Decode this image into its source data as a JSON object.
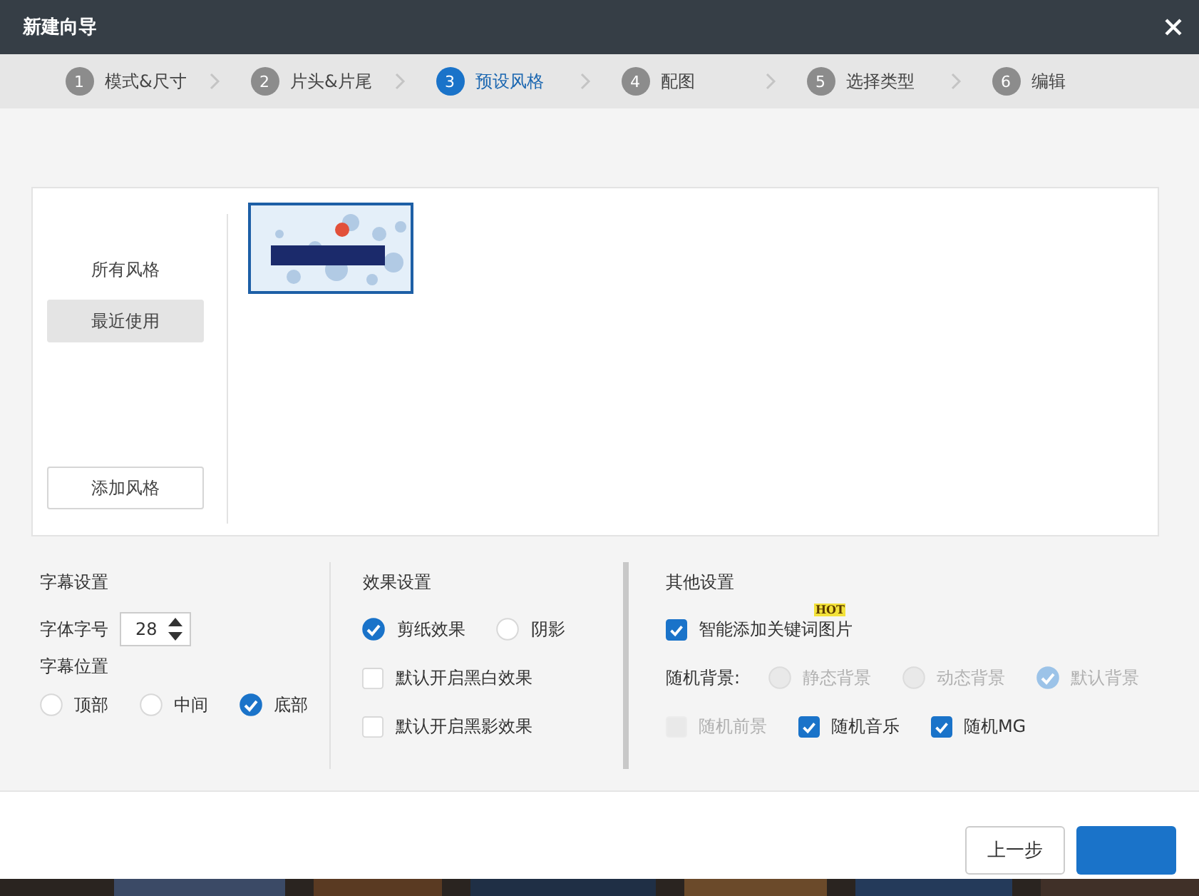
{
  "window": {
    "title": "新建向导"
  },
  "steps": [
    {
      "number": "1",
      "label": "模式&尺寸",
      "selected": false
    },
    {
      "number": "2",
      "label": "片头&片尾",
      "selected": false
    },
    {
      "number": "3",
      "label": "预设风格",
      "selected": true
    },
    {
      "number": "4",
      "label": "配图",
      "selected": false
    },
    {
      "number": "5",
      "label": "选择类型",
      "selected": false
    },
    {
      "number": "6",
      "label": "编辑",
      "selected": false
    }
  ],
  "style_panel": {
    "categories": [
      {
        "label": "所有风格",
        "selected": false
      },
      {
        "label": "最近使用",
        "selected": true
      }
    ],
    "add_button": "添加风格",
    "thumbnails": [
      {
        "kind": "picture",
        "selected": true
      }
    ]
  },
  "subtitle_settings": {
    "title": "字幕设置",
    "font_size": {
      "label": "字体字号",
      "value": "28"
    },
    "position": {
      "label": "字幕位置",
      "options": [
        {
          "label": "顶部",
          "selected": false
        },
        {
          "label": "中间",
          "selected": false
        },
        {
          "label": "底部",
          "selected": true
        }
      ]
    }
  },
  "effect_settings": {
    "title": "效果设置",
    "styles": [
      {
        "label": "剪纸效果",
        "selected": true
      },
      {
        "label": "阴影",
        "selected": false
      }
    ],
    "checkboxes": [
      {
        "label": "默认开启黑白效果",
        "checked": false
      },
      {
        "label": "默认开启黑影效果",
        "checked": false
      }
    ]
  },
  "other_settings": {
    "title": "其他设置",
    "smart_images": {
      "label": "智能添加关键词图片",
      "checked": true,
      "badge": "HOT"
    },
    "random_background": {
      "label": "随机背景:",
      "options": [
        {
          "label": "静态背景",
          "selected": false,
          "disabled": true
        },
        {
          "label": "动态背景",
          "selected": false,
          "disabled": true
        },
        {
          "label": "默认背景",
          "selected": true,
          "disabled": true
        }
      ]
    },
    "randoms": [
      {
        "label": "随机前景",
        "checked": false,
        "disabled": true
      },
      {
        "label": "随机音乐",
        "checked": true,
        "disabled": false
      },
      {
        "label": "随机MG",
        "checked": true,
        "disabled": false
      }
    ]
  },
  "footer": {
    "buttons": [
      {
        "kind": "secondary",
        "label": "上一步"
      },
      {
        "kind": "primary"
      }
    ]
  }
}
